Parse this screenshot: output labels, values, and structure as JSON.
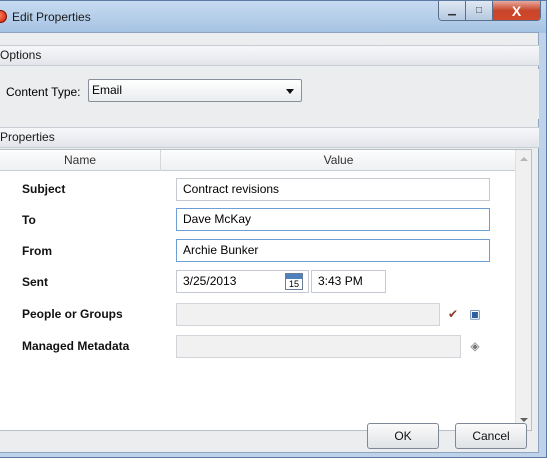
{
  "window": {
    "title": "Edit Properties",
    "minimize_glyph": "▁",
    "maximize_glyph": "□",
    "close_glyph": "X"
  },
  "options": {
    "section_title": "Options",
    "content_type_label": "Content Type:",
    "content_type_value": "Email"
  },
  "properties": {
    "section_title": "Properties",
    "columns": {
      "name": "Name",
      "value": "Value"
    },
    "subject": {
      "label": "Subject",
      "value": "Contract revisions"
    },
    "to": {
      "label": "To",
      "value": "Dave McKay"
    },
    "from": {
      "label": "From",
      "value": "Archie Bunker"
    },
    "sent": {
      "label": "Sent",
      "date": "3/25/2013",
      "time": "3:43 PM",
      "calendar_day": "15"
    },
    "people": {
      "label": "People or Groups",
      "value": ""
    },
    "metadata": {
      "label": "Managed Metadata",
      "value": ""
    }
  },
  "buttons": {
    "ok": "OK",
    "cancel": "Cancel"
  },
  "icons": {
    "app": "app-icon",
    "calendar": "calendar-icon",
    "check_names": "check-names-icon",
    "address_book": "address-book-icon",
    "tag": "tag-icon"
  }
}
